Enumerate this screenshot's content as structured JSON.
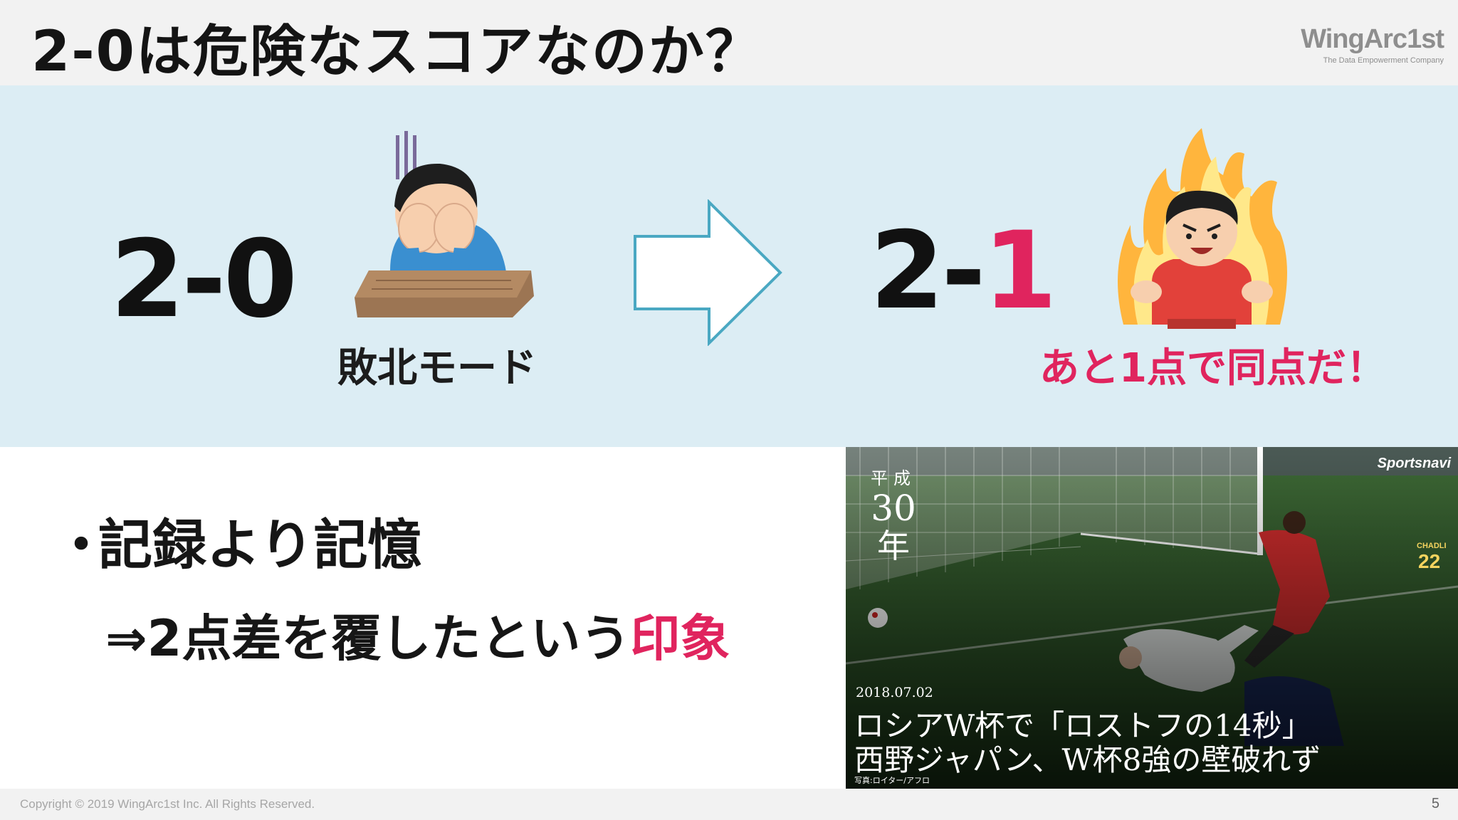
{
  "slide": {
    "title": "2-0は危険なスコアなのか？",
    "logo": {
      "name": "WingArc1st",
      "tagline": "The Data Empowerment Company"
    }
  },
  "comparison": {
    "left": {
      "score": "2-0",
      "caption": "敗北モード",
      "icon": "head-in-hands-illustration"
    },
    "arrow": "right-arrow-icon",
    "right": {
      "score_prefix": "2-",
      "score_highlight": "1",
      "caption": "あと1点で同点だ！",
      "icon": "fired-up-illustration"
    }
  },
  "bullets": {
    "marker": "・",
    "main": "記録より記憶",
    "sub_prefix": "⇒2点差を覆したという",
    "sub_highlight": "印象"
  },
  "photo": {
    "brand": "Sportsnavi",
    "era_line1": "平成",
    "era_line2": "30",
    "era_line3": "年",
    "date": "2018.07.02",
    "headline1": "ロシアW杯で「ロストフの14秒」",
    "headline2": "西野ジャパン、W杯8強の壁破れず",
    "credit": "写真:ロイター/アフロ",
    "jersey_name": "CHADLI",
    "jersey_number": "22"
  },
  "footer": {
    "copyright": "Copyright © 2019 WingArc1st Inc.  All Rights Reserved.",
    "page_number": "5"
  },
  "colors": {
    "accent": "#e0245e",
    "band": "#dcedf4",
    "arrow_stroke": "#4aa8c2"
  }
}
